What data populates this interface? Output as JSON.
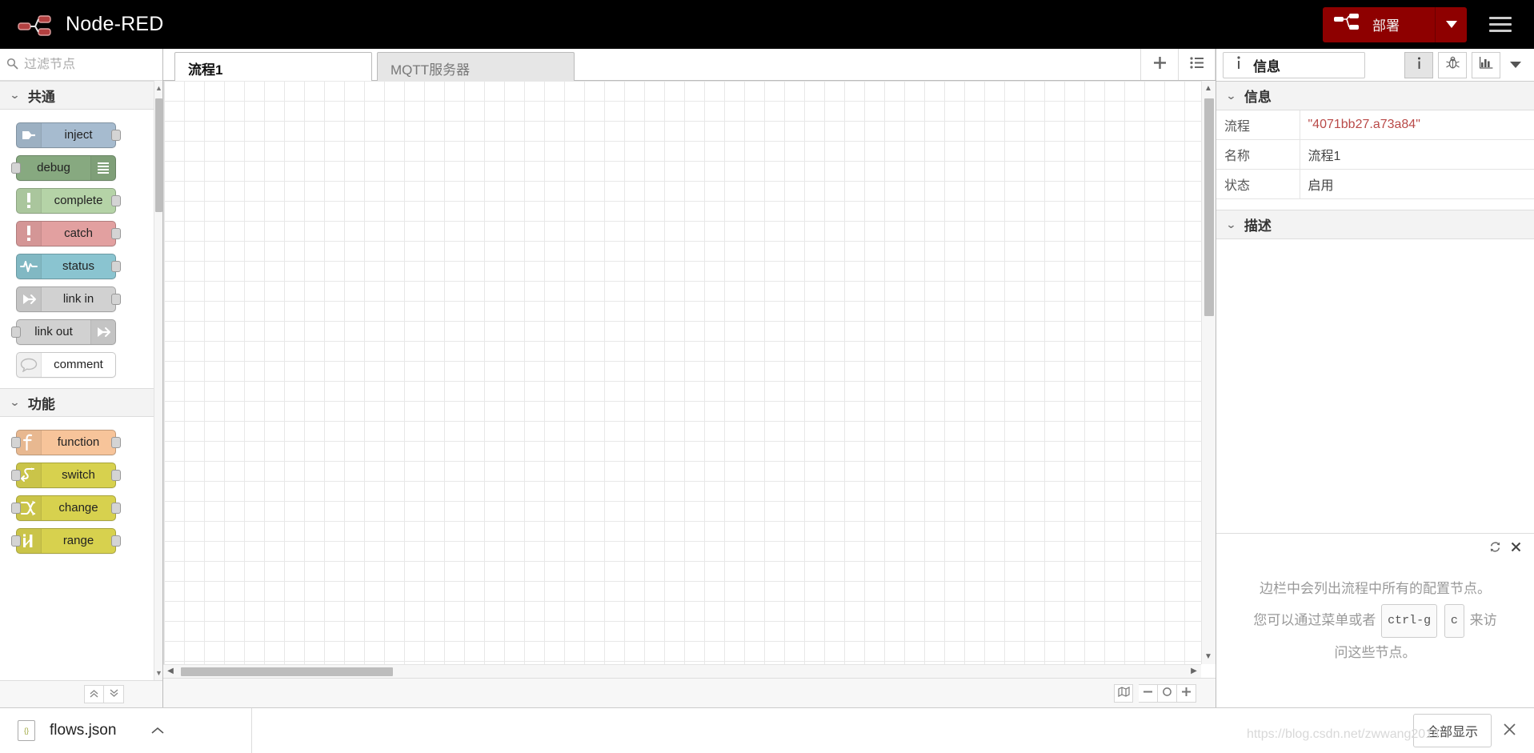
{
  "header": {
    "brand_title": "Node-RED",
    "logo_icon": "node-red-logo-icon",
    "deploy_label": "部署",
    "deploy_icon": "deploy-node-icon",
    "deploy_caret_icon": "chevron-down-icon",
    "menu_icon": "hamburger-menu-icon",
    "deploy_color": "#8e0000",
    "header_bg": "#000000"
  },
  "palette": {
    "search_placeholder": "过滤节点",
    "search_value": "",
    "search_icon": "search-icon",
    "categories": [
      {
        "name": "共通",
        "collapse_icon": "chevron-down-icon",
        "nodes": [
          {
            "label": "inject",
            "icon": "inject-arrow-icon",
            "color": "#a6bbcf",
            "icon_side": "left",
            "has_input": false,
            "has_output": true
          },
          {
            "label": "debug",
            "icon": "debug-lines-icon",
            "color": "#87a980",
            "icon_side": "right",
            "has_input": true,
            "has_output": false
          },
          {
            "label": "complete",
            "icon": "exclamation-icon",
            "color": "#b5d3a7",
            "icon_side": "left",
            "has_input": false,
            "has_output": true
          },
          {
            "label": "catch",
            "icon": "exclamation-icon",
            "color": "#e2a0a0",
            "icon_side": "left",
            "has_input": false,
            "has_output": true
          },
          {
            "label": "status",
            "icon": "pulse-wave-icon",
            "color": "#8ac4d0",
            "icon_side": "left",
            "has_input": false,
            "has_output": true
          },
          {
            "label": "link in",
            "icon": "link-arrow-icon",
            "color": "#d1d1d1",
            "icon_side": "left",
            "has_input": false,
            "has_output": true
          },
          {
            "label": "link out",
            "icon": "link-arrow-icon",
            "color": "#d1d1d1",
            "icon_side": "right",
            "has_input": true,
            "has_output": false
          },
          {
            "label": "comment",
            "icon": "speech-bubble-icon",
            "color": "#ffffff",
            "icon_side": "left",
            "has_input": false,
            "has_output": false
          }
        ]
      },
      {
        "name": "功能",
        "collapse_icon": "chevron-down-icon",
        "nodes": [
          {
            "label": "function",
            "icon": "function-f-icon",
            "color": "#f7c49a",
            "icon_side": "left",
            "has_input": true,
            "has_output": true
          },
          {
            "label": "switch",
            "icon": "switch-branch-icon",
            "color": "#d7d14e",
            "icon_side": "left",
            "has_input": true,
            "has_output": true
          },
          {
            "label": "change",
            "icon": "change-swap-icon",
            "color": "#d7d14e",
            "icon_side": "left",
            "has_input": true,
            "has_output": true
          },
          {
            "label": "range",
            "icon": "range-bars-icon",
            "color": "#d7d14e",
            "icon_side": "left",
            "has_input": true,
            "has_output": true
          }
        ]
      }
    ],
    "footer": {
      "collapse_all_icon": "chevrons-up-icon",
      "expand_all_icon": "chevrons-down-icon"
    }
  },
  "editor": {
    "tabs": [
      {
        "label": "流程1",
        "active": true
      },
      {
        "label": "MQTT服务器",
        "active": false
      }
    ],
    "add_tab_icon": "plus-icon",
    "list_tabs_icon": "list-icon",
    "footer": {
      "navigator_icon": "map-navigator-icon",
      "zoom_out_icon": "minus-icon",
      "zoom_reset_icon": "circle-icon",
      "zoom_in_icon": "plus-icon"
    }
  },
  "sidebar": {
    "active_tab": {
      "label": "信息",
      "icon": "info-i-icon"
    },
    "tab_icons": [
      {
        "name": "info-i-icon",
        "glyph": "i",
        "active": true
      },
      {
        "name": "debug-bug-icon",
        "glyph": "bug",
        "active": false
      },
      {
        "name": "dashboard-chart-icon",
        "glyph": "chart",
        "active": false
      },
      {
        "name": "chevron-down-icon",
        "glyph": "caret",
        "active": false
      }
    ],
    "info_section": {
      "title": "信息",
      "collapse_icon": "chevron-down-icon",
      "rows": [
        {
          "key": "流程",
          "value": "\"4071bb27.a73a84\"",
          "value_color": "#b94a48"
        },
        {
          "key": "名称",
          "value": "流程1",
          "value_color": "#444444"
        },
        {
          "key": "状态",
          "value": "启用",
          "value_color": "#444444"
        }
      ]
    },
    "desc_section": {
      "title": "描述",
      "collapse_icon": "chevron-down-icon"
    },
    "config_nodes": {
      "refresh_icon": "refresh-icon",
      "close_icon": "close-x-icon",
      "message_line1": "边栏中会列出流程中所有的配置节点。",
      "message_line2_a": "您可以通过菜单或者",
      "key1": "ctrl-g",
      "key2": "c",
      "message_line2_b": "来访",
      "message_line3": "问这些节点。"
    }
  },
  "bottombar": {
    "file_icon": "json-file-icon",
    "file_name": "flows.json",
    "collapse_icon": "chevron-up-icon",
    "show_all_label": "全部显示",
    "close_icon": "close-x-icon"
  },
  "watermark": "https://blog.csdn.net/zwwang2014"
}
